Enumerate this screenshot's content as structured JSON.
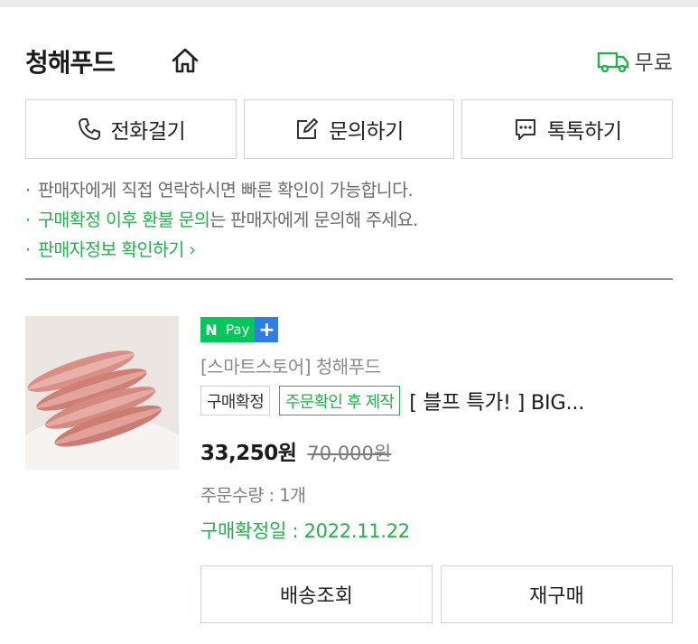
{
  "seller": {
    "name": "청해푸드",
    "shipping_label": "무료"
  },
  "contact_buttons": {
    "call_label": "전화걸기",
    "inquiry_label": "문의하기",
    "talk_label": "톡톡하기"
  },
  "notices": {
    "line1": "판매자에게 직접 연락하시면 빠른 확인이 가능합니다.",
    "line2_highlight": "구매확정 이후 환불 문의",
    "line2_rest": "는 판매자에게 문의해 주세요.",
    "line3_link": "판매자정보 확인하기"
  },
  "product": {
    "npay_n": "N",
    "npay_label": "Pay",
    "npay_plus": "+",
    "store": "[스마트스토어] 청해푸드",
    "badge_confirmed": "구매확정",
    "badge_made_to_order": "주문확인 후 제작",
    "title": "[ 블프 특가! ] BIG...",
    "price": "33,250원",
    "original_price": "70,000원",
    "quantity": "주문수량 : 1개",
    "confirm_date": "구매확정일 : 2022.11.22"
  },
  "actions": {
    "tracking_label": "배송조회",
    "reorder_label": "재구매"
  },
  "colors": {
    "accent_green": "#22b14c",
    "npay_green": "#03c75a",
    "npay_blue": "#2d7ee6"
  }
}
